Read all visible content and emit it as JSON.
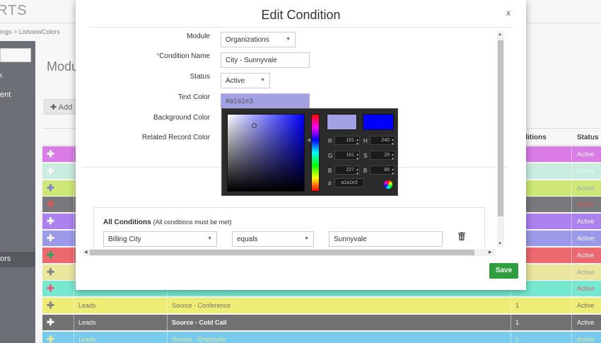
{
  "app": {
    "brand": "RTS",
    "breadcrumb": "ings > ListviewColors",
    "main_title": "Modu",
    "add_button": "Add"
  },
  "sidebar": {
    "item_k": "k",
    "item_ent": "ent",
    "active_item": "ors"
  },
  "table": {
    "headers": {
      "conditions": "ditions",
      "status": "Status"
    },
    "rows": [
      {
        "color": "#e080f0",
        "plus": "#ffffff",
        "module": "",
        "field": "",
        "count": "",
        "status": "Active",
        "text": "#ffffff"
      },
      {
        "color": "#cff5e8",
        "plus": "#ffffff",
        "module": "",
        "field": "",
        "count": "",
        "status": "Active",
        "text": "#e8fff8"
      },
      {
        "color": "#d4f07a",
        "plus": "#8888cc",
        "module": "",
        "field": "",
        "count": "",
        "status": "Active",
        "text": "#9fb0c0"
      },
      {
        "color": "#7d7d82",
        "plus": "#e05a5a",
        "module": "",
        "field": "",
        "count": "",
        "status": "Active",
        "text": "#e05a5a"
      },
      {
        "color": "#b186f5",
        "plus": "#ffffff",
        "module": "",
        "field": "",
        "count": "",
        "status": "Active",
        "text": "#ffffff"
      },
      {
        "color": "#9f9ff0",
        "plus": "#ffffff",
        "module": "",
        "field": "",
        "count": "",
        "status": "Active",
        "text": "#ffffff"
      },
      {
        "color": "#f46d73",
        "plus": "#33aa66",
        "module": "",
        "field": "",
        "count": "",
        "status": "Active",
        "text": "#ffffff"
      },
      {
        "color": "#f3eea4",
        "plus": "#888888",
        "module": "",
        "field": "",
        "count": "",
        "status": "Active",
        "text": "#aaaaaa"
      },
      {
        "color": "#7af0d6",
        "plus": "#f06080",
        "module": "",
        "field": "",
        "count": "",
        "status": "Active",
        "text": "#f06080"
      },
      {
        "color": "#f5f57a",
        "plus": "#888888",
        "module": "Leads",
        "field": "Source - Conference",
        "count": "1",
        "status": "Active",
        "text": "#777777"
      },
      {
        "color": "#757578",
        "plus": "#ffffff",
        "module": "Leads",
        "field": "Source - Cold Call",
        "count": "1",
        "status": "Active",
        "text": "#ffffff"
      },
      {
        "color": "#7cd2f5",
        "plus": "#f0f0a0",
        "module": "Leads",
        "field": "Source - Employee",
        "count": "1",
        "status": "Active",
        "text": "#f0f0a0"
      }
    ]
  },
  "modal": {
    "title": "Edit Condition",
    "close": "x",
    "labels": {
      "module": "Module",
      "condition_name_req": "*",
      "condition_name": "Condition Name",
      "status": "Status",
      "text_color": "Text Color",
      "background_color": "Background Color",
      "related_record_color": "Related Record Color"
    },
    "module_value": "Organizations",
    "condition_name_value": "City - Sunnyvale",
    "status_value": "Active",
    "text_color_value": "#a1a1e3",
    "conditions": {
      "title": "All Conditions",
      "subtitle": "(All conditions must be met)",
      "field": "Billing City",
      "operator": "equals",
      "value": "Sunnyvale"
    },
    "save": "Save"
  },
  "color_picker": {
    "new_color": "#a1a1e3",
    "current_color": "#0000ff",
    "r_label": "R",
    "r": "161",
    "g_label": "G",
    "g": "161",
    "b_label": "B",
    "b": "227",
    "h_label": "H",
    "h": "240",
    "s_label": "S",
    "s": "29",
    "v_label": "B",
    "v": "89",
    "hex_label": "#",
    "hex": "a1a1e3"
  }
}
